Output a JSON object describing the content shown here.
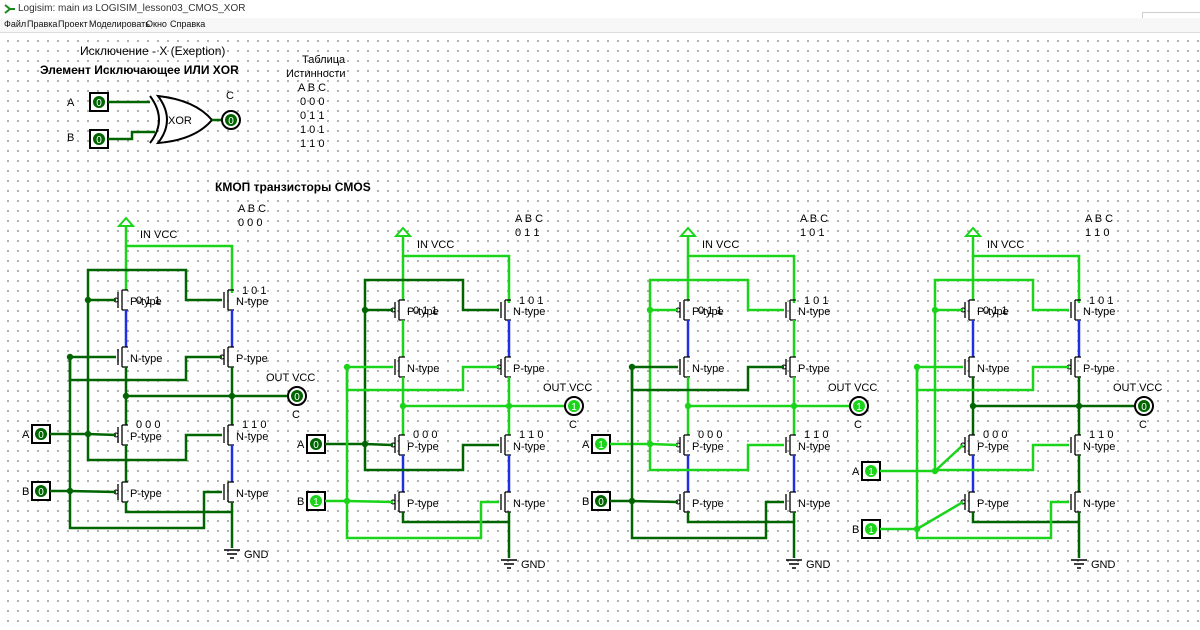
{
  "window": {
    "title": "Logisim: main из LOGISIM_lesson03_CMOS_XOR"
  },
  "menu": [
    "Файл",
    "Правка",
    "Проект",
    "Моделировать",
    "Окно",
    "Справка"
  ],
  "colors": {
    "wire_high": "#1ad41a",
    "wire_low": "#006400",
    "wire_undefined": "#2030e0"
  },
  "header": {
    "subtitle": "Исключение - X (Exeption)",
    "title": "Элемент Исключающее ИЛИ  XOR",
    "gate_label": "XOR",
    "truth_title_1": "Таблица",
    "truth_title_2": "Истинности",
    "truth_header": "A  B  C",
    "truth_rows": [
      "0  0  0",
      "0  1  1",
      "1  0  1",
      "1  1  0"
    ],
    "a_label": "A",
    "b_label": "B",
    "c_label": "C",
    "a_value": "0",
    "b_value": "0",
    "c_value": "0"
  },
  "cmos_title": "КМОП транзисторы CMOS",
  "labels": {
    "vcc": "IN VCC",
    "gnd": "GND",
    "out": "OUT VCC",
    "ptype": "P-type",
    "ntype": "N-type",
    "abc": "A  B  C",
    "c011": "0  1  1",
    "c101": "1  0  1",
    "c000": "0  0  0",
    "c110": "1  1  0"
  },
  "circuits": [
    {
      "state": "0  0  0",
      "a": "0",
      "b": "0",
      "c": "0"
    },
    {
      "state": "0  1  1",
      "a": "0",
      "b": "1",
      "c": "1"
    },
    {
      "state": "1  0  1",
      "a": "1",
      "b": "0",
      "c": "1"
    },
    {
      "state": "1  1  0",
      "a": "1",
      "b": "1",
      "c": "0"
    }
  ]
}
